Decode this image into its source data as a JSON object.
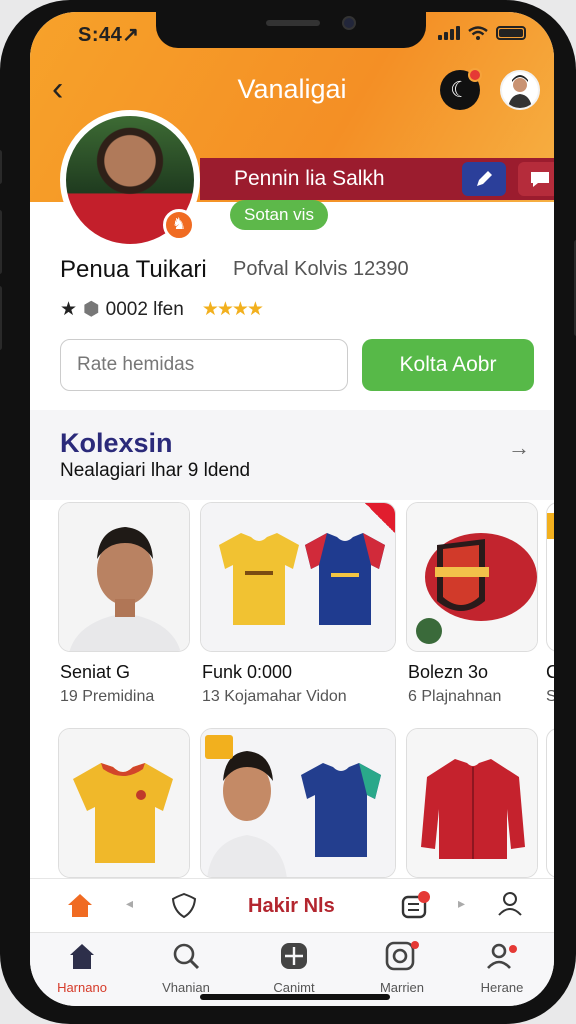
{
  "status_bar": {
    "time": "S:44↗"
  },
  "header": {
    "title": "Vanaligai"
  },
  "profile": {
    "ribbon_name": "Pennin lia Salkh",
    "status": "Sotan vis",
    "name": "Penua Tuikari",
    "meta": "Pofval Kolvis 12390",
    "stats_text": "0002 lfen"
  },
  "search": {
    "placeholder": "Rate hemidas"
  },
  "action_button": {
    "label": "Kolta Aobr"
  },
  "collection": {
    "title": "Kolexsin",
    "subtitle": "Nealagiari lhar 9 ldend",
    "cards": [
      {
        "title": "Seniat G",
        "sub": "19 Premidina"
      },
      {
        "title": "Funk 0:000",
        "sub": "13 Kojamahar Vidon"
      },
      {
        "title": "Bolezn 3o",
        "sub": "6 Plajnahnan"
      },
      {
        "title": "C",
        "sub": "S"
      }
    ]
  },
  "tab_strip": {
    "center_label": "Hakir Nls"
  },
  "bottom_nav": {
    "items": [
      {
        "label": "Harnano",
        "icon": "home-icon",
        "active": true
      },
      {
        "label": "Vhanian",
        "icon": "search-icon"
      },
      {
        "label": "Canimt",
        "icon": "collection-icon"
      },
      {
        "label": "Marrien",
        "icon": "camera-icon"
      },
      {
        "label": "Herane",
        "icon": "profile-icon"
      }
    ]
  },
  "colors": {
    "header": "#f48f25",
    "ribbon": "#9b1c2e",
    "accent_green": "#57b948",
    "title_purple": "#2b2a7a"
  }
}
